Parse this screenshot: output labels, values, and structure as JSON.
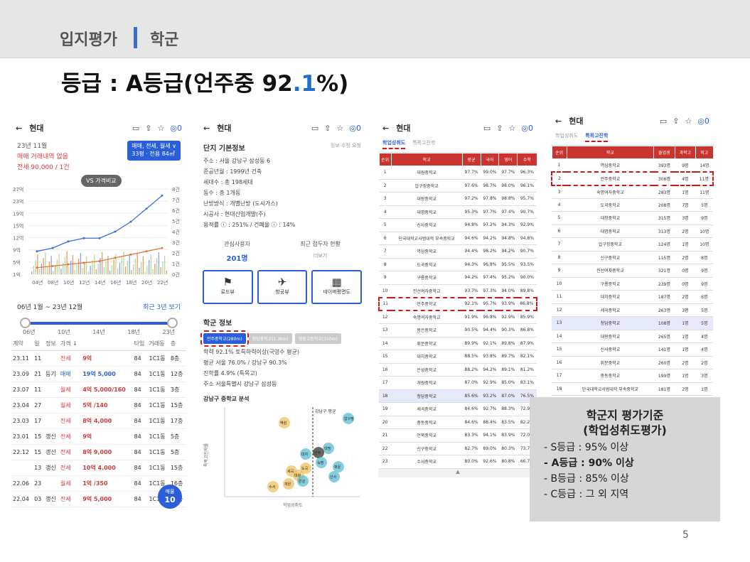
{
  "header": {
    "section": "입지평가",
    "topic": "학군"
  },
  "headline": {
    "prefix": "등급 : A등급(언주중 92",
    "dot": ".",
    "digit": "1",
    "suffix": "%)"
  },
  "common": {
    "back": "←",
    "apt_name": "현대",
    "comment_count": "0"
  },
  "panel1": {
    "month": "23년 11월",
    "no_deal": "매매 거래내역 없음",
    "price": "전세 90,000 / 1건",
    "badge_line1": "매매, 전세, 월세 ∨",
    "badge_line2": "33평 · 전용 84㎡",
    "vs_button": "VS 가격비교",
    "chart_left_ticks": [
      "27억",
      "23억",
      "19억",
      "15억",
      "12억",
      "9억",
      "5억",
      "1억"
    ],
    "chart_right_ticks": [
      "8건",
      "7건",
      "6건",
      "5건",
      "4건",
      "3건",
      "2건",
      "1건",
      "0건"
    ],
    "chart_x_ticks": [
      "04년",
      "08년",
      "10년",
      "12년",
      "14년",
      "16년",
      "18년",
      "20년",
      "22년"
    ],
    "range_label": "06년 1월 ~ 23년 12월",
    "recent_link": "최근 3년 보기",
    "slider_ticks": [
      "06년",
      "10년",
      "14년",
      "18년",
      "23년"
    ],
    "table_headers": [
      "계약",
      "일",
      "정보",
      "가격 ↓",
      "",
      "타입",
      "거래동",
      "층"
    ],
    "rows": [
      {
        "date": "23.11",
        "day": "11",
        "info": "",
        "type": "전세",
        "price": "9억",
        "area": "84",
        "dong": "1C1동",
        "floor": "8층"
      },
      {
        "date": "23.09",
        "day": "21",
        "info": "등기",
        "type": "매매",
        "price": "19억 5,000",
        "area": "84",
        "dong": "1C1동",
        "floor": "12층"
      },
      {
        "date": "23.07",
        "day": "11",
        "info": "",
        "type": "월세",
        "price": "4억 5,000/160",
        "area": "84",
        "dong": "1C1동",
        "floor": "3층"
      },
      {
        "date": "23.04",
        "day": "27",
        "info": "",
        "type": "월세",
        "price": "5억 /140",
        "area": "84",
        "dong": "1C1동",
        "floor": "15층"
      },
      {
        "date": "23.03",
        "day": "17",
        "info": "",
        "type": "전세",
        "price": "8억 4,000",
        "area": "84",
        "dong": "1C1동",
        "floor": "17층"
      },
      {
        "date": "23.01",
        "day": "15",
        "info": "갱신",
        "type": "전세",
        "price": "9억",
        "area": "84",
        "dong": "1C1동",
        "floor": "5층"
      },
      {
        "date": "22.12",
        "day": "15",
        "info": "갱신",
        "type": "전세",
        "price": "8억 9,000",
        "area": "84",
        "dong": "1C1동",
        "floor": "5층"
      },
      {
        "date": "",
        "day": "13",
        "info": "갱신",
        "type": "전세",
        "price": "10억 4,000",
        "area": "84",
        "dong": "1C1동",
        "floor": "15층"
      },
      {
        "date": "22.06",
        "day": "23",
        "info": "",
        "type": "월세",
        "price": "1억 /350",
        "area": "84",
        "dong": "1C1동",
        "floor": "16층"
      },
      {
        "date": "22.04",
        "day": "03",
        "info": "갱신",
        "type": "전세",
        "price": "9억 5,000",
        "area": "84",
        "dong": "1C1동",
        "floor": "16층"
      }
    ],
    "fab_top": "매물",
    "fab_count": "10"
  },
  "panel2": {
    "basic_title": "단지 기본정보",
    "edit_request": "정보 수정 요청",
    "info": [
      "주소 : 서울 강남구 삼성동 6",
      "준공년월 : 1999년 건축",
      "세대수 : 총 198세대",
      "동수 : 총 1개동",
      "난방방식 : 개별난방 (도시가스)",
      "시공사 : 현대산업개발(주)",
      "용적률 ⓘ : 251% / 건폐율 ⓘ : 14%"
    ],
    "interest_label": "관심사용자",
    "interest_value": "201명",
    "visit_label": "최근 접두자 현황",
    "visit_value": "더보기",
    "tiles": [
      "로드뷰",
      "항공뷰",
      "네이버평면도"
    ],
    "school_title": "학군 정보",
    "chips": [
      "언주중학교(280m)",
      "청담중학교(1.3km)",
      "영동고등학교(310m)"
    ],
    "school_lines": [
      "학력 92.1% 토특하력이상(국영수 평균)",
      "평균 서울 76.0% / 강남구 90.3%",
      "진학률 4.9% (특목고)",
      "주소 서울특별시 강남구 삼성동"
    ],
    "scatter_title": "강남구 중학교 분석",
    "scatter_ylabel": "특목고진학률",
    "scatter_xlabel": "학업성취도",
    "scatter_refline": "강남구 평균",
    "scatter_labels": [
      "역삼",
      "압구정",
      "대명",
      "언주",
      "숙명",
      "대치",
      "세곡",
      "대왕",
      "은성",
      "도곡",
      "수서",
      "신사",
      "개원",
      "휘문"
    ]
  },
  "panel3": {
    "tab_active": "학업성취도",
    "tab_other": "특목고진학",
    "headers": [
      "순위",
      "학교",
      "평균",
      "국어",
      "영어",
      "수학"
    ],
    "rows": [
      [
        "1",
        "대원중학교",
        "97.7%",
        "99.0%",
        "97.7%",
        "96.3%"
      ],
      [
        "2",
        "압구정중학교",
        "97.6%",
        "98.7%",
        "98.0%",
        "96.1%"
      ],
      [
        "3",
        "대왕중학교",
        "97.2%",
        "97.8%",
        "98.8%",
        "95.7%"
      ],
      [
        "4",
        "대명중학교",
        "95.3%",
        "97.7%",
        "97.4%",
        "90.7%"
      ],
      [
        "5",
        "신사중학교",
        "94.8%",
        "97.2%",
        "94.3%",
        "92.9%"
      ],
      [
        "6",
        "단국대학교사범대학 부속중학교",
        "94.6%",
        "94.2%",
        "94.8%",
        "94.8%"
      ],
      [
        "7",
        "역삼중학교",
        "94.4%",
        "98.2%",
        "94.2%",
        "90.7%"
      ],
      [
        "8",
        "도곡중학교",
        "94.3%",
        "96.8%",
        "95.5%",
        "93.5%"
      ],
      [
        "9",
        "구룡중학교",
        "94.2%",
        "97.4%",
        "95.2%",
        "90.0%"
      ],
      [
        "10",
        "진선여자중학교",
        "93.7%",
        "97.3%",
        "94.0%",
        "89.8%"
      ],
      [
        "11",
        "언주중학교",
        "92.1%",
        "95.7%",
        "93.9%",
        "86.8%"
      ],
      [
        "12",
        "숙명여자중학교",
        "91.9%",
        "96.8%",
        "92.9%",
        "85.9%"
      ],
      [
        "13",
        "봉은중학교",
        "90.5%",
        "94.4%",
        "90.3%",
        "86.8%"
      ],
      [
        "14",
        "휘문중학교",
        "89.9%",
        "92.1%",
        "89.8%",
        "87.9%"
      ],
      [
        "15",
        "대치중학교",
        "88.5%",
        "93.8%",
        "89.7%",
        "82.1%"
      ],
      [
        "16",
        "은성중학교",
        "88.2%",
        "94.2%",
        "89.1%",
        "81.2%"
      ],
      [
        "17",
        "개원중학교",
        "87.0%",
        "92.9%",
        "85.0%",
        "83.1%"
      ],
      [
        "18",
        "청담중학교",
        "85.6%",
        "93.2%",
        "87.0%",
        "76.5%"
      ],
      [
        "19",
        "세곡중학교",
        "84.6%",
        "92.7%",
        "88.3%",
        "72.9%"
      ],
      [
        "20",
        "중동중학교",
        "84.6%",
        "88.4%",
        "83.5%",
        "82.2%"
      ],
      [
        "21",
        "언북중학교",
        "83.3%",
        "94.1%",
        "83.9%",
        "72.0%"
      ],
      [
        "22",
        "신구중학교",
        "82.7%",
        "89.0%",
        "80.3%",
        "73.7%"
      ],
      [
        "23",
        "수서중학교",
        "80.0%",
        "92.6%",
        "80.8%",
        "66.7%"
      ]
    ],
    "more": "▲"
  },
  "panel4": {
    "tab_other": "학업성취도",
    "tab_active": "특목고진학",
    "headers": [
      "순위",
      "학교",
      "졸업생",
      "과학고",
      "외고"
    ],
    "rows": [
      [
        "1",
        "역삼중학교",
        "393명",
        "9명",
        "14명"
      ],
      [
        "2",
        "언주중학교",
        "306명",
        "4명",
        "11명"
      ],
      [
        "3",
        "숙명여자중학교",
        "283명",
        "1명",
        "11명"
      ],
      [
        "4",
        "도곡중학교",
        "208명",
        "7명",
        "5명"
      ],
      [
        "5",
        "대청중학교",
        "315명",
        "3명",
        "9명"
      ],
      [
        "6",
        "대명중학교",
        "313명",
        "2명",
        "10명"
      ],
      [
        "7",
        "압구정중학교",
        "124명",
        "1명",
        "10명"
      ],
      [
        "8",
        "신구중학교",
        "115명",
        "2명",
        "8명"
      ],
      [
        "9",
        "진선여자중학교",
        "321명",
        "0명",
        "9명"
      ],
      [
        "10",
        "구룡중학교",
        "239명",
        "0명",
        "9명"
      ],
      [
        "11",
        "대치중학교",
        "187명",
        "2명",
        "6명"
      ],
      [
        "12",
        "세곡중학교",
        "263명",
        "3명",
        "5명"
      ],
      [
        "13",
        "청담중학교",
        "108명",
        "1명",
        "5명"
      ],
      [
        "14",
        "대왕중학교",
        "265명",
        "1명",
        "4명"
      ],
      [
        "15",
        "신사중학교",
        "141명",
        "1명",
        "4명"
      ],
      [
        "16",
        "휘문중학교",
        "260명",
        "2명",
        "2명"
      ],
      [
        "17",
        "중동중학교",
        "199명",
        "1명",
        "3명"
      ],
      [
        "18",
        "단국대학교사범대학 부속중학교",
        "181명",
        "2명",
        "1명"
      ]
    ]
  },
  "criteria": {
    "title1": "학군지 평가기준",
    "title2": "(학업성취도평가)",
    "lines": [
      "- S등급 : 95% 이상",
      "- A등급 : 90% 이상",
      "- B등급 : 85% 이상",
      "- C등급 : 그 외 지역"
    ]
  },
  "page_number": "5",
  "colors": {
    "accent_blue": "#2b5fd9",
    "highlight_red": "#d01818",
    "table_header": "#c9342e",
    "title_blue": "#1f6fd1"
  },
  "chart_data": {
    "type": "line",
    "x": [
      "04년",
      "08년",
      "10년",
      "12년",
      "14년",
      "16년",
      "18년",
      "20년",
      "22년"
    ],
    "series": [
      {
        "values": [
          8,
          9,
          11,
          12,
          12,
          14,
          17,
          21,
          25
        ]
      },
      {
        "values": [
          3,
          3.5,
          4,
          4.5,
          5,
          6,
          7,
          8,
          9
        ]
      }
    ]
  }
}
